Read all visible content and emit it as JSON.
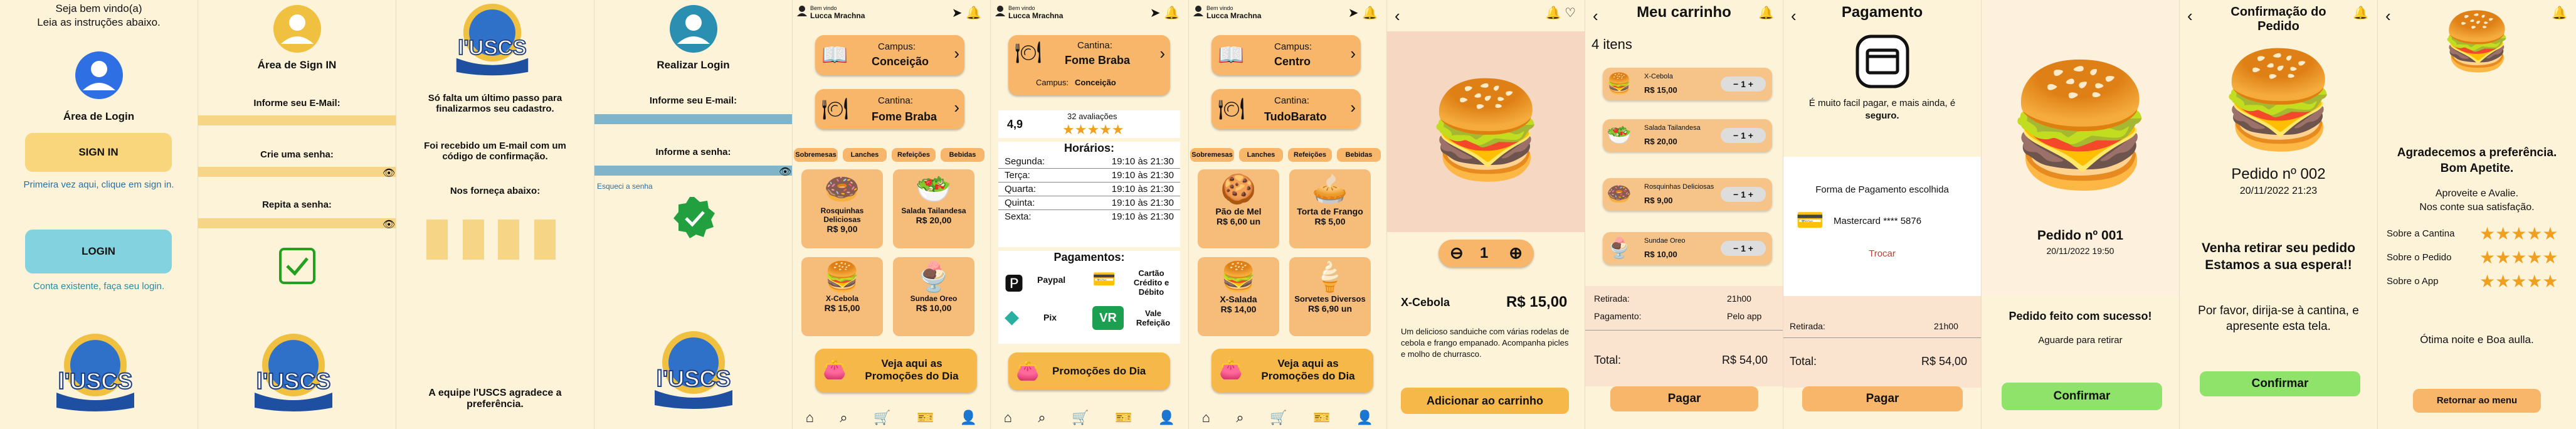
{
  "s1": {
    "welcome": "Seja bem vindo(a)",
    "instructions": "Leia as instruções abaixo.",
    "login_area": "Área de Login",
    "sign_in": "SIGN IN",
    "first_time": "Primeira vez aqui, clique em sign in.",
    "login": "LOGIN",
    "existing": "Conta existente, faça seu login."
  },
  "s2": {
    "title": "Área de Sign IN",
    "email": "Informe seu E-Mail:",
    "password": "Crie uma senha:",
    "repeat": "Repita a senha:"
  },
  "s3": {
    "logo": "l'USCS",
    "text1": "Só falta um último passo para finalizarmos seu cadastro.",
    "text2": "Foi recebido um E-mail com um código de confirmação.",
    "text3": "Nos forneça abaixo:",
    "thanks": "A equipe l'USCS agradece a preferência."
  },
  "s4": {
    "title": "Realizar Login",
    "email": "Informe seu E-mail:",
    "password": "Informe a senha:",
    "forgot": "Esqueci a senha"
  },
  "s5": {
    "welcome": "Bem vindo",
    "user": "Lucca Mrachna",
    "campus_label": "Campus:",
    "campus": "Conceição",
    "cantina_label": "Cantina:",
    "cantina": "Fome Braba",
    "cats": [
      "Sobremesas",
      "Lanches",
      "Refeições",
      "Bebidas"
    ],
    "items": [
      {
        "name": "Rosquinhas Deliciosas",
        "price": "R$ 9,00"
      },
      {
        "name": "Salada Tailandesa",
        "price": "R$ 20,00"
      },
      {
        "name": "X-Cebola",
        "price": "R$ 15,00"
      },
      {
        "name": "Sundae Oreo",
        "price": "R$ 10,00"
      }
    ],
    "promo": "Veja aqui as Promoções do Dia"
  },
  "s6": {
    "welcome": "Bem vindo",
    "user": "Lucca Mrachna",
    "cantina_label": "Cantina:",
    "cantina": "Fome Braba",
    "campus_label": "Campus:",
    "campus": "Conceição",
    "rating": "4,9",
    "reviews": "32 avaliações",
    "stars": 4.9,
    "hours_title": "Horários:",
    "hours": [
      {
        "day": "Segunda:",
        "time": "19:10 às 21:30"
      },
      {
        "day": "Terça:",
        "time": "19:10 às 21:30"
      },
      {
        "day": "Quarta:",
        "time": "19:10 às 21:30"
      },
      {
        "day": "Quinta:",
        "time": "19:10 às 21:30"
      },
      {
        "day": "Sexta:",
        "time": "19:10 às 21:30"
      }
    ],
    "payments_title": "Pagamentos:",
    "payments": [
      "Paypal",
      "Cartão Crédito e Débito",
      "Pix",
      "Vale Refeição"
    ],
    "promo": "Promoções do Dia"
  },
  "s7": {
    "welcome": "Bem vindo",
    "user": "Lucca Mrachna",
    "campus_label": "Campus:",
    "campus": "Centro",
    "cantina_label": "Cantina:",
    "cantina": "TudoBarato",
    "cats": [
      "Sobremesas",
      "Lanches",
      "Refeições",
      "Bebidas"
    ],
    "items": [
      {
        "name": "Pão de Mel",
        "price": "R$ 6,00 un"
      },
      {
        "name": "Torta de Frango",
        "price": "R$ 5,00"
      },
      {
        "name": "X-Salada",
        "price": "R$ 14,00"
      },
      {
        "name": "Sorvetes Diversos",
        "price": "R$ 6,90 un"
      }
    ],
    "promo": "Veja aqui as Promoções do Dia"
  },
  "s8": {
    "qty": "1",
    "name": "X-Cebola",
    "price": "R$ 15,00",
    "desc": "Um delicioso sanduiche com várias rodelas de cebola e frango empanado. Acompanha picles e molho de churrasco.",
    "add": "Adicionar ao carrinho"
  },
  "s9": {
    "title": "Meu carrinho",
    "count": "4 itens",
    "items": [
      {
        "name": "X-Cebola",
        "price": "R$ 15,00",
        "qty": "1"
      },
      {
        "name": "Salada Tailandesa",
        "price": "R$ 20,00",
        "qty": "1"
      },
      {
        "name": "Rosquinhas Deliciosas",
        "price": "R$ 9,00",
        "qty": "1"
      },
      {
        "name": "Sundae Oreo",
        "price": "R$ 10,00",
        "qty": "1"
      }
    ],
    "pickup_label": "Retirada:",
    "pickup": "21h00",
    "payment_label": "Pagamento:",
    "payment": "Pelo app",
    "total_label": "Total:",
    "total": "R$ 54,00",
    "pay": "Pagar"
  },
  "s10": {
    "title": "Pagamento",
    "note": "É muito facil pagar, e mais ainda, é",
    "note_b": "seguro.",
    "method_title": "Forma de Pagamento escolhida",
    "card": "Mastercard **** 5876",
    "change": "Trocar",
    "pickup_label": "Retirada:",
    "pickup": "21h00",
    "total_label": "Total:",
    "total": "R$ 54,00",
    "pay": "Pagar"
  },
  "s11": {
    "order": "Pedido nº 001",
    "date": "20/11/2022 19:50",
    "success": "Pedido feito com sucesso!",
    "wait": "Aguarde para retirar",
    "confirm": "Confirmar"
  },
  "s12": {
    "title": "Confirmação do Pedido",
    "order": "Pedido nº 002",
    "date": "20/11/2022 21:23",
    "ready": "Venha retirar seu pedido Estamos a sua espera!!",
    "instr": "Por favor, dirija-se à cantina, e apresente esta tela.",
    "confirm": "Confirmar"
  },
  "s13": {
    "thanks": "Agradecemos a preferência. Bom Apetite.",
    "rate": "Aproveite e Avalie.",
    "rate2": "Nos conte sua satisfação.",
    "ratings": [
      {
        "label": "Sobre a Cantina",
        "stars": 5
      },
      {
        "label": "Sobre o Pedido",
        "stars": 5
      },
      {
        "label": "Sobre o App",
        "stars": 5
      }
    ],
    "bye": "Ótima noite e Boa aulla.",
    "back": "Retornar ao menu"
  },
  "colors": {
    "bg": "#fdf3d9",
    "orange": "#f7b66a",
    "yellow": "#f9d67b",
    "green": "#8fe36a",
    "cyan": "#82d2e0"
  }
}
